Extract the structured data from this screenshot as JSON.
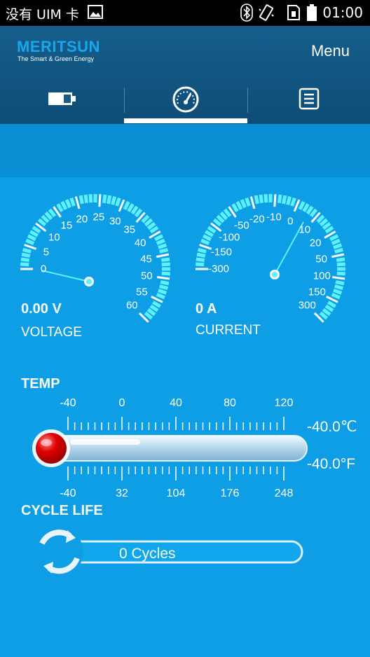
{
  "status_bar": {
    "carrier": "没有 UIM 卡",
    "time": "01:00",
    "icons": [
      "image-icon",
      "bluetooth-icon",
      "vibrate-icon",
      "sim-icon",
      "battery-icon"
    ]
  },
  "header": {
    "brand": "MERITSUN",
    "tagline": "The Smart & Green Energy",
    "menu_label": "Menu",
    "tabs": [
      {
        "icon": "battery-icon",
        "selected": false
      },
      {
        "icon": "gauge-icon",
        "selected": true
      },
      {
        "icon": "list-icon",
        "selected": false
      }
    ]
  },
  "voltage": {
    "value": "0.00 V",
    "caption": "VOLTAGE",
    "reading": 0,
    "ticks": [
      "0",
      "5",
      "10",
      "15",
      "20",
      "25",
      "30",
      "35",
      "40",
      "45",
      "50",
      "55",
      "60"
    ]
  },
  "current": {
    "value": "0 A",
    "caption": "CURRENT",
    "reading": 0,
    "ticks": [
      "-300",
      "-150",
      "-100",
      "-50",
      "-20",
      "-10",
      "0",
      "10",
      "20",
      "50",
      "100",
      "150",
      "300"
    ]
  },
  "temp": {
    "title": "TEMP",
    "celsius_ticks": [
      "-40",
      "0",
      "40",
      "80",
      "120"
    ],
    "fahrenheit_ticks": [
      "-40",
      "32",
      "104",
      "176",
      "248"
    ],
    "celsius_reading": "-40.0℃",
    "fahrenheit_reading": "-40.0°F",
    "level": 0
  },
  "cycle_life": {
    "title": "CYCLE LIFE",
    "text": "0 Cycles"
  },
  "colors": {
    "background": "#0e9ee6",
    "header": "#0e4d76",
    "gauge_accent": "#5ff0ff",
    "brand": "#1aa6ea",
    "bulb": "#d40000"
  }
}
